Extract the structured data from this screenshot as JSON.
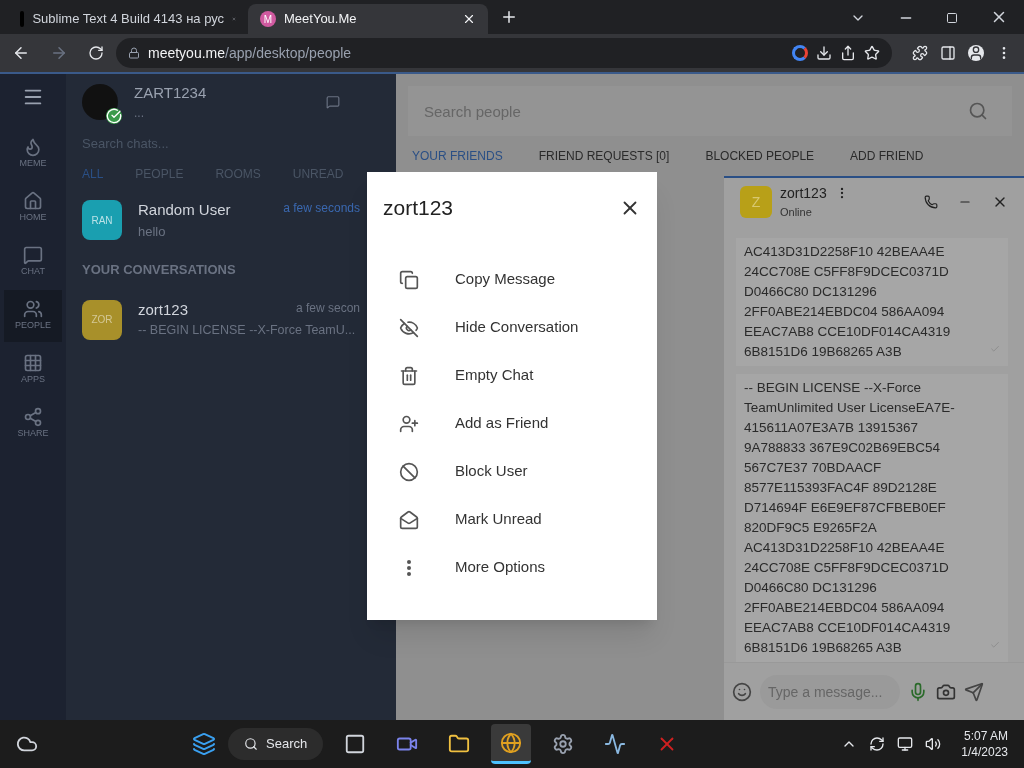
{
  "browser": {
    "tabs": [
      {
        "title": "Sublime Text 4 Build 4143 на рус",
        "selected": false
      },
      {
        "title": "MeetYou.Me",
        "icon_letter": "M",
        "selected": true
      }
    ],
    "url_host": "meetyou.me",
    "url_path": "/app/desktop/people"
  },
  "nav": [
    {
      "label": "MEME",
      "selected": false
    },
    {
      "label": "HOME",
      "selected": false
    },
    {
      "label": "CHAT",
      "selected": false
    },
    {
      "label": "PEOPLE",
      "selected": true
    },
    {
      "label": "APPS",
      "selected": false
    },
    {
      "label": "SHARE",
      "selected": false
    }
  ],
  "profile": {
    "name": "ZART1234",
    "status": "...",
    "online": true
  },
  "chat_search": {
    "placeholder": "Search chats..."
  },
  "chat_tabs": [
    {
      "label": "ALL",
      "selected": true
    },
    {
      "label": "PEOPLE",
      "selected": false
    },
    {
      "label": "ROOMS",
      "selected": false
    },
    {
      "label": "UNREAD",
      "selected": false
    }
  ],
  "recent": {
    "avatar": "RAN",
    "color": "#1a9fb0",
    "name": "Random User",
    "preview": "hello",
    "time": "a few seconds"
  },
  "section_title": "YOUR CONVERSATIONS",
  "conversations": [
    {
      "avatar": "ZOR",
      "color": "#a8902a",
      "name": "zort123",
      "preview": "-- BEGIN LICENSE --X-Force TeamU...",
      "time": "a few secon"
    }
  ],
  "people_search": {
    "placeholder": "Search people"
  },
  "people_tabs": [
    {
      "label": "YOUR FRIENDS",
      "selected": true
    },
    {
      "label": "FRIEND REQUESTS [0]",
      "selected": false
    },
    {
      "label": "BLOCKED PEOPLE",
      "selected": false
    },
    {
      "label": "ADD FRIEND",
      "selected": false
    }
  ],
  "chat_window": {
    "avatar": "Z",
    "name": "zort123",
    "status": "Online",
    "input_placeholder": "Type a message...",
    "messages": [
      {
        "lines": [
          "AC413D31D2258F10 42BEAA4E",
          "24CC708E C5FF8F9DCEC0371D",
          "D0466C80 DC131296",
          "2FF0ABE214EBDC04 586AA094",
          "EEAC7AB8 CCE10DF014CA4319",
          "6B8151D6 19B68265 A3B"
        ]
      },
      {
        "lines": [
          "-- BEGIN LICENSE --X-Force",
          "TeamUnlimited User LicenseEA7E-",
          "415611A07E3A7B 13915367",
          "9A788833 367E9C02B69EBC54",
          "567C7E37 70BDAACF",
          "8577E115393FAC4F 89D2128E",
          "D714694F E6E9EF87CFBEB0EF",
          "820DF9C5 E9265F2A",
          "AC413D31D2258F10 42BEAA4E",
          "24CC708E C5FF8F9DCEC0371D",
          "D0466C80 DC131296",
          "2FF0ABE214EBDC04 586AA094",
          "EEAC7AB8 CCE10DF014CA4319",
          "6B8151D6 19B68265 A3B"
        ]
      }
    ]
  },
  "dialog": {
    "title": "zort123",
    "items": [
      "Copy Message",
      "Hide Conversation",
      "Empty Chat",
      "Add as Friend",
      "Block User",
      "Mark Unread",
      "More Options"
    ]
  },
  "taskbar": {
    "search": "Search",
    "time": "5:07 AM",
    "date": "1/4/2023",
    "apps": [
      {
        "selected": false
      },
      {
        "selected": false
      },
      {
        "selected": false
      },
      {
        "selected": true
      },
      {
        "selected": false
      },
      {
        "selected": false
      },
      {
        "selected": false
      }
    ]
  }
}
